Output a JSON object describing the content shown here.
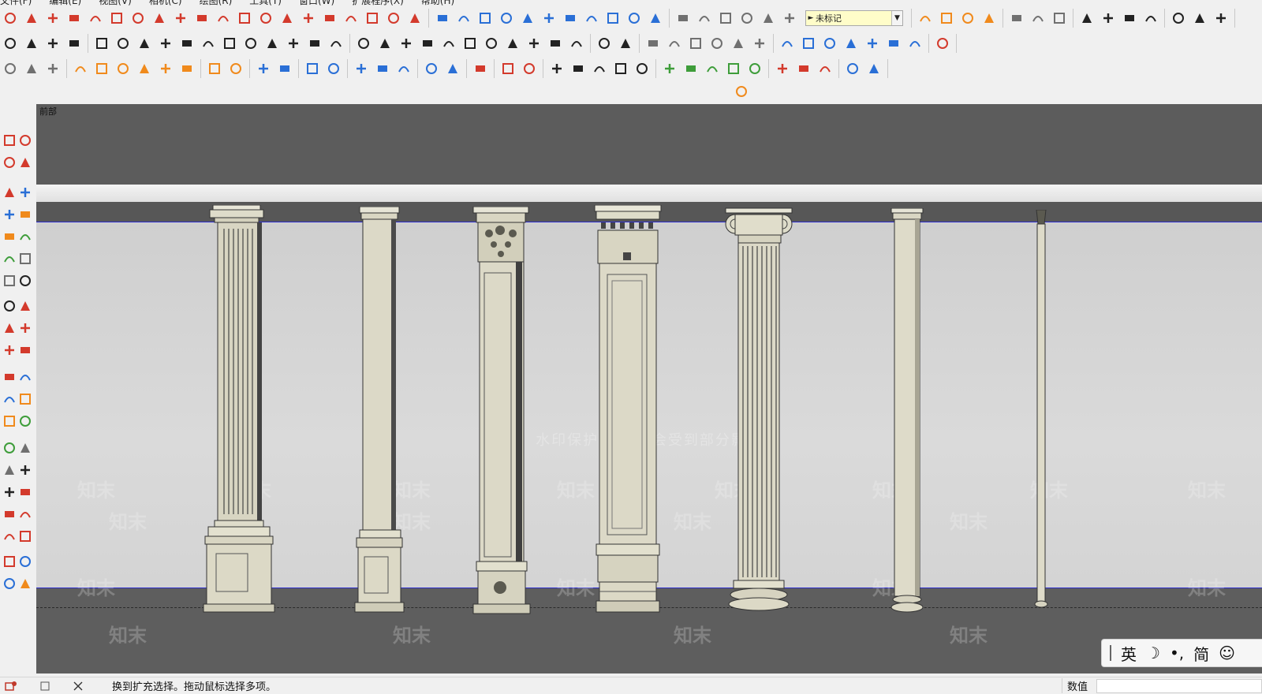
{
  "menu": {
    "items": [
      "文件(F)",
      "编辑(E)",
      "视图(V)",
      "相机(C)",
      "绘图(R)",
      "工具(T)",
      "窗口(W)",
      "扩展程序(X)",
      "帮助(H)"
    ]
  },
  "toolbar": {
    "tag_selector_value": "未标记",
    "colors": {
      "red": "#d33a2c",
      "blue": "#2a6fd6",
      "orange": "#f08a1c",
      "green": "#3e9d3a",
      "gray": "#707070",
      "dark": "#222222"
    }
  },
  "scene": {
    "tab_label": "前部",
    "watermark_text": "水印保护区   画质会受到部分影响",
    "watermark_logo": "知末",
    "columns": [
      {
        "name": "fluted-square-pilaster"
      },
      {
        "name": "plain-square-pilaster"
      },
      {
        "name": "carved-ornate-pilaster"
      },
      {
        "name": "paneled-dentil-pilaster"
      },
      {
        "name": "ionic-fluted-column"
      },
      {
        "name": "plain-round-column"
      },
      {
        "name": "slender-round-column"
      }
    ]
  },
  "ime": {
    "lang": "英",
    "moon": "☽",
    "punct": "•,",
    "script": "简",
    "emoji": "☺"
  },
  "status": {
    "hint": "换到扩充选择。拖动鼠标选择多项。",
    "measure_label": "数值"
  }
}
